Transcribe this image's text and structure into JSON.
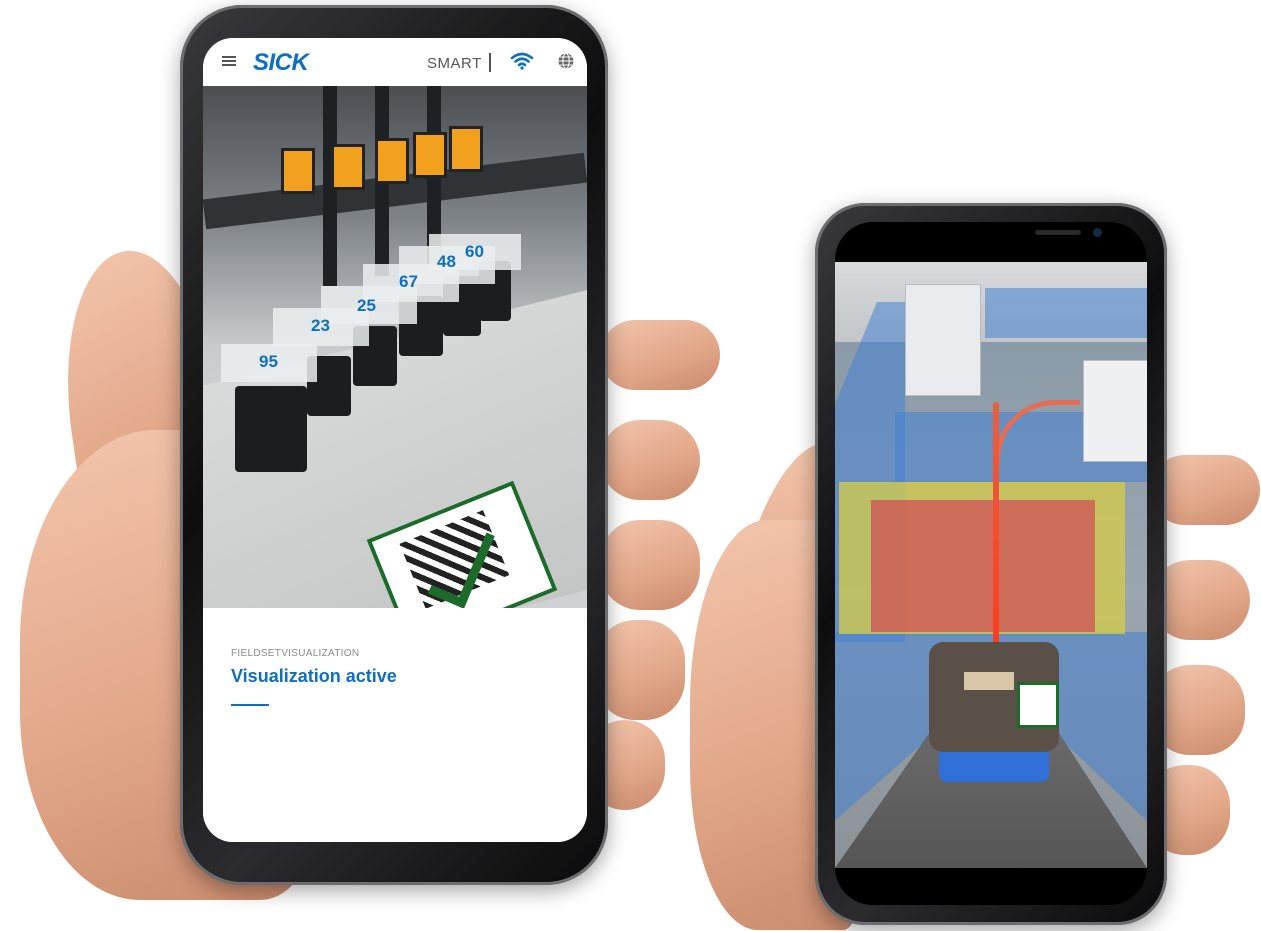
{
  "left_phone": {
    "app_bar": {
      "brand": "SICK",
      "mode_label": "SMART",
      "separator": "|",
      "icons": [
        "menu-icon",
        "wifi-icon",
        "globe-icon"
      ]
    },
    "ar_labels": [
      "95",
      "23",
      "25",
      "67",
      "48",
      "60"
    ],
    "panel": {
      "caption": "FIELDSETVISUALIZATION",
      "status": "Visualization active"
    },
    "colors": {
      "accent": "#0e6fc0"
    }
  },
  "right_phone": {
    "zones": [
      "blue-field",
      "yellow-warning-field",
      "red-protective-field"
    ],
    "colors": {
      "warning": "#d6cd46",
      "protective": "#d05858",
      "blue": "#4682d2"
    }
  }
}
